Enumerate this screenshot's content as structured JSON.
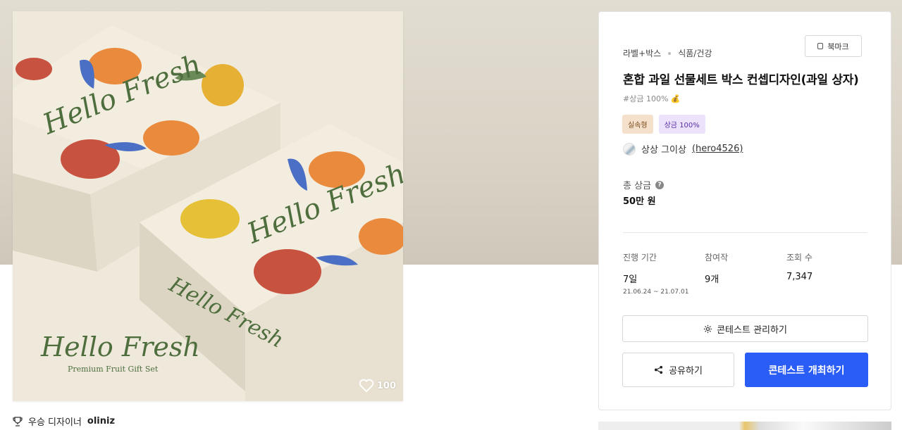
{
  "product": {
    "like_count": "100",
    "image_text": {
      "brand": "Hello Fresh",
      "subtitle": "Premium Fruit Gift Set"
    }
  },
  "winner": {
    "label": "우승 디자이너",
    "name": "oliniz"
  },
  "contest": {
    "category": "라벨+박스",
    "subcategory": "식품/건강",
    "bookmark_label": "북마크",
    "title": "혼합 과일 선물세트 박스 컨셉디자인(과일 상자)",
    "tagline": "#상금 100% 💰",
    "badges": [
      "실속형",
      "상금 100%"
    ],
    "host_name": "상상 그이상",
    "host_id": "(hero4526)",
    "prize_label": "총 상금",
    "prize_value": "50만 원",
    "stats": {
      "period_label": "진행 기간",
      "period_value": "7일",
      "period_dates": "21.06.24 ~ 21.07.01",
      "entries_label": "참여작",
      "entries_value": "9개",
      "views_label": "조회 수",
      "views_value": "7,347"
    },
    "manage_label": "콘테스트 관리하기",
    "share_label": "공유하기",
    "host_contest_label": "콘테스트 개최하기"
  },
  "colors": {
    "primary": "#2a5cf6",
    "badge_a_bg": "#f5e0cc",
    "badge_b_bg": "#ece2fb"
  }
}
